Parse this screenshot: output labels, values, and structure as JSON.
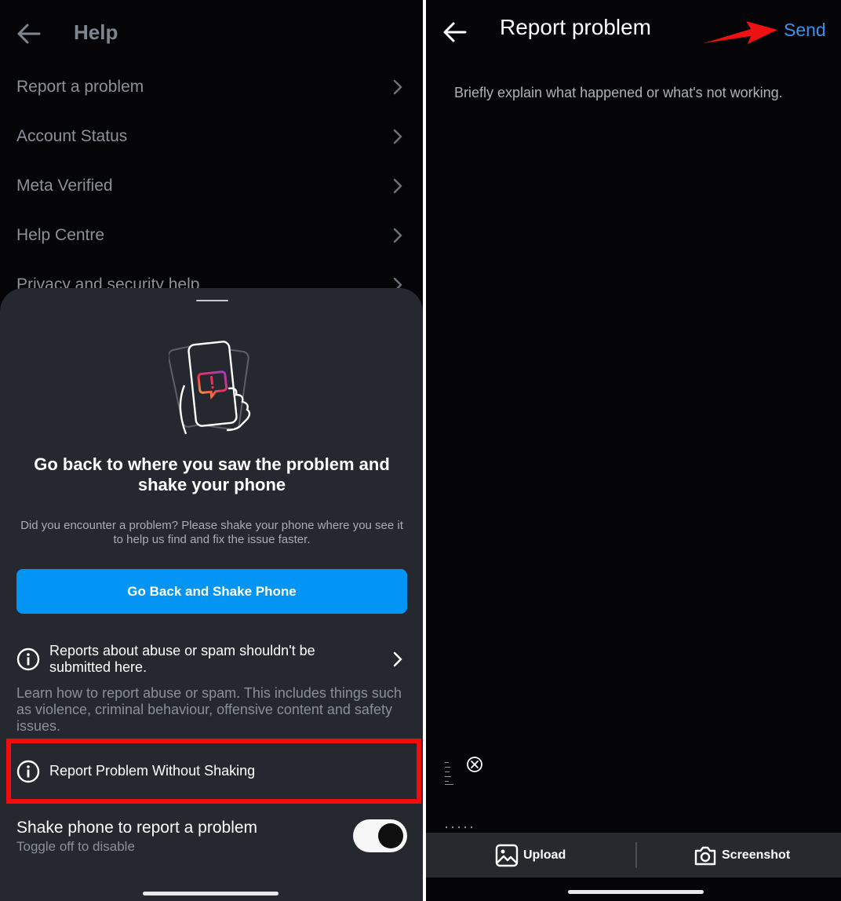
{
  "left": {
    "header": {
      "title": "Help"
    },
    "menu": [
      {
        "label": "Report a problem"
      },
      {
        "label": "Account Status"
      },
      {
        "label": "Meta Verified"
      },
      {
        "label": "Help Centre"
      },
      {
        "label": "Privacy and security help"
      }
    ],
    "sheet": {
      "title": "Go back to where you saw the problem and shake your phone",
      "description": "Did you encounter a problem? Please shake your phone where you see it to help us find and fix the issue faster.",
      "primary_button": "Go Back and Shake Phone",
      "abuse_notice": "Reports about abuse or spam shouldn't be submitted here.",
      "learn_more": "Learn how to report abuse or spam. This includes things such as violence, criminal behaviour, offensive content and safety issues.",
      "report_without_shaking": "Report Problem Without Shaking",
      "shake_toggle": {
        "title": "Shake phone to report a problem",
        "subtitle": "Toggle off to disable",
        "on": true
      }
    }
  },
  "right": {
    "header": {
      "title": "Report problem",
      "send": "Send"
    },
    "placeholder": "Briefly explain what happened or what's not working.",
    "bottom_bar": {
      "upload": "Upload",
      "screenshot": "Screenshot"
    }
  },
  "colors": {
    "background": "#050507",
    "sheet": "#25282e",
    "primary_button": "#0395f6",
    "send_link": "#3a92f0",
    "highlight": "#f20c0c"
  },
  "icons": [
    "back-arrow-icon",
    "chevron-right-icon",
    "phone-shake-illustration",
    "info-icon",
    "image-icon",
    "camera-icon",
    "close-circle-icon",
    "red-annotation-arrow"
  ]
}
